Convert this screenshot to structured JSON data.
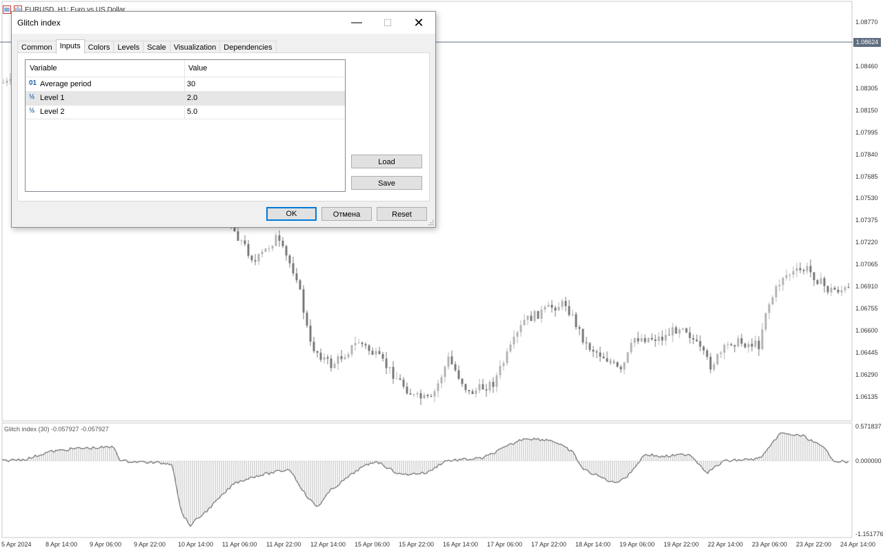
{
  "chart": {
    "header_title": "EURUSD, H1:  Euro vs US Dollar",
    "current_price": "1.08624",
    "price_labels": [
      "1.08770",
      "1.08460",
      "1.08305",
      "1.08150",
      "1.07995",
      "1.07840",
      "1.07685",
      "1.07530",
      "1.07375",
      "1.07220",
      "1.07065",
      "1.06910",
      "1.06755",
      "1.06600",
      "1.06445",
      "1.06290",
      "1.06135"
    ],
    "indicator_title": "Glitch index (30) -0.057927 -0.057927",
    "indicator_labels": [
      "0.571837",
      "0.000000",
      "-1.151776"
    ],
    "time_labels": [
      "5 Apr 2024",
      "8 Apr 14:00",
      "9 Apr 06:00",
      "9 Apr 22:00",
      "10 Apr 14:00",
      "11 Apr 06:00",
      "11 Apr 22:00",
      "12 Apr 14:00",
      "15 Apr 06:00",
      "15 Apr 22:00",
      "16 Apr 14:00",
      "17 Apr 06:00",
      "17 Apr 22:00",
      "18 Apr 14:00",
      "19 Apr 06:00",
      "19 Apr 22:00",
      "22 Apr 14:00",
      "23 Apr 06:00",
      "23 Apr 22:00",
      "24 Apr 14:00"
    ]
  },
  "dialog": {
    "title": "Glitch index",
    "tabs": [
      "Common",
      "Inputs",
      "Colors",
      "Levels",
      "Scale",
      "Visualization",
      "Dependencies"
    ],
    "active_tab": "Inputs",
    "columns": [
      "Variable",
      "Value"
    ],
    "rows": [
      {
        "icon": "01",
        "name": "Average period",
        "value": "30"
      },
      {
        "icon": "½",
        "name": "Level 1",
        "value": "2.0"
      },
      {
        "icon": "½",
        "name": "Level 2",
        "value": "5.0"
      }
    ],
    "buttons": {
      "load": "Load",
      "save": "Save",
      "ok": "OK",
      "cancel": "Отмена",
      "reset": "Reset"
    }
  },
  "colors": {
    "accent": "#0078d7",
    "price_tag": "#5f6e80",
    "candle": "#8c8c8c",
    "indicator": "#a0a0a0"
  }
}
